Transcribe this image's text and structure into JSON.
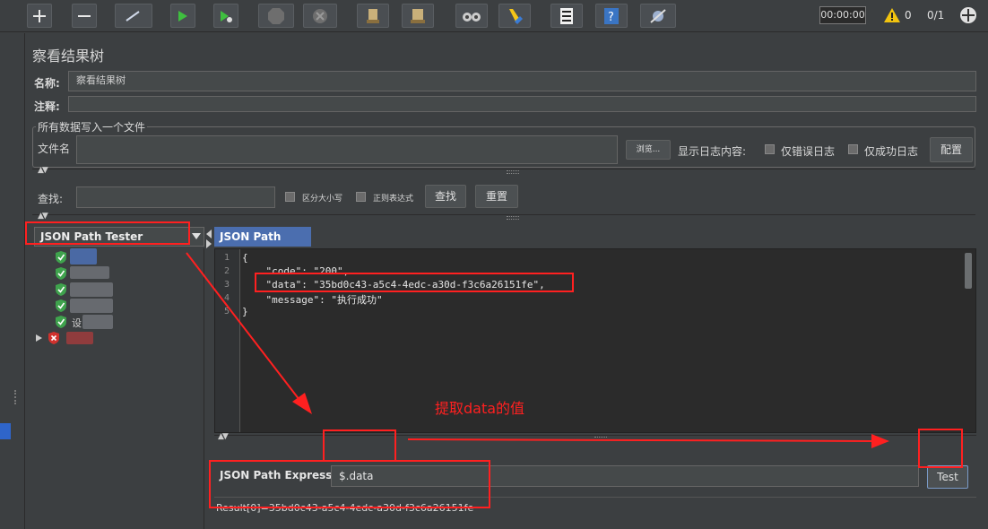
{
  "toolbar": {
    "buttons": [
      "add",
      "remove",
      "toggle",
      "start",
      "start-no-pause",
      "stop",
      "shutdown",
      "clear",
      "clear-all",
      "search",
      "reset-search",
      "function-helper",
      "help",
      "remote"
    ],
    "timer": "00:00:00",
    "warning_count": "0",
    "thread_count": "0/1"
  },
  "panel": {
    "title": "察看结果树",
    "name_label": "名称:",
    "name_value": "察看结果树",
    "comment_label": "注释:",
    "comment_value": "",
    "file_group_title": "所有数据写入一个文件",
    "file_name_label": "文件名",
    "file_name_value": "",
    "browse_label": "浏览...",
    "log_content_label": "显示日志内容:",
    "errors_only_label": "仅错误日志",
    "success_only_label": "仅成功日志",
    "configure_label": "配置"
  },
  "search": {
    "label": "查找:",
    "value": "",
    "case_sensitive_label": "区分大小写",
    "regex_label": "正则表达式",
    "search_button": "查找",
    "reset_button": "重置"
  },
  "renderer": {
    "selected": "JSON Path Tester"
  },
  "tree": {
    "items": [
      {
        "label": "",
        "status": "success"
      },
      {
        "label": "",
        "status": "success"
      },
      {
        "label": "",
        "status": "success"
      },
      {
        "label": "",
        "status": "success"
      },
      {
        "label": "设",
        "status": "success"
      },
      {
        "label": "",
        "status": "error"
      }
    ]
  },
  "tester": {
    "tab_label": "JSON Path Tester",
    "line_numbers": [
      "1",
      "2",
      "3",
      "4",
      "5"
    ],
    "code_lines": [
      "{",
      "    \"code\": \"200\",",
      "    \"data\": \"35bd0c43-a5c4-4edc-a30d-f3c6a26151fe\",",
      "    \"message\": \"执行成功\"",
      "}"
    ],
    "expression_label": "JSON Path Expression",
    "expression_value": "$.data",
    "test_button": "Test",
    "result": "Result[0]=35bd0c43-a5c4-4edc-a30d-f3c6a26151fe"
  },
  "annotation": {
    "text": "提取data的值",
    "color": "#ff2020"
  },
  "colors": {
    "background": "#3c3f41",
    "tab_accent": "#4b6eaf",
    "success": "#3fa34d",
    "error": "#d0312d"
  }
}
